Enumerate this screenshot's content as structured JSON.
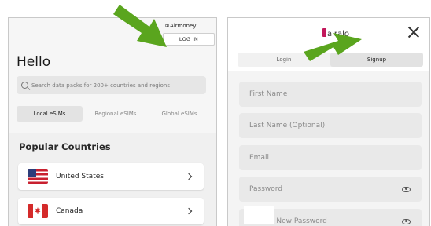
{
  "left_screen": {
    "brand": {
      "mark": "⊞",
      "name": "Airmoney"
    },
    "login_button": "LOG IN",
    "heading": "Hello",
    "search": {
      "placeholder": "Search data packs for 200+ countries and regions"
    },
    "tabs": [
      {
        "label": "Local eSIMs",
        "active": true
      },
      {
        "label": "Regional eSIMs",
        "active": false
      },
      {
        "label": "Global eSIMs",
        "active": false
      }
    ],
    "popular_title": "Popular Countries",
    "countries": [
      {
        "name": "United States",
        "flag_icon": "us-flag-icon"
      },
      {
        "name": "Canada",
        "flag_icon": "canada-flag-icon"
      }
    ]
  },
  "right_screen": {
    "logo": "airalo",
    "close_icon": "close-icon",
    "auth_tabs": [
      {
        "label": "Login",
        "active": false
      },
      {
        "label": "Signup",
        "active": true
      }
    ],
    "fields": [
      {
        "label": "First Name",
        "has_eye": false
      },
      {
        "label": "Last Name (Optional)",
        "has_eye": false
      },
      {
        "label": "Email",
        "has_eye": false
      },
      {
        "label": "Password",
        "has_eye": true
      },
      {
        "label": "Retype New Password",
        "has_eye": true
      }
    ]
  },
  "annotations": {
    "arrow_color": "#5aa51e",
    "arrow_icons": [
      "arrow-to-login-button-icon",
      "arrow-to-signup-tab-icon"
    ]
  },
  "colors": {
    "accent_logo": "#c2185b",
    "us_red": "#c8202f",
    "us_blue": "#2d3d7a",
    "canada_red": "#d42a2a"
  }
}
